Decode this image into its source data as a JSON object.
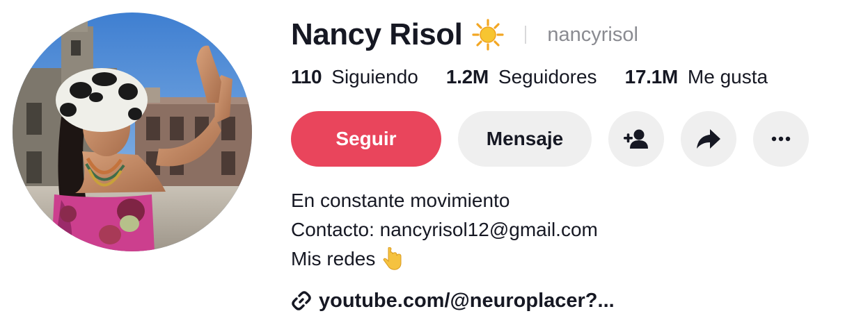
{
  "profile": {
    "display_name": "Nancy Risol",
    "name_emoji": "sun-emoji",
    "username": "nancyrisol"
  },
  "stats": [
    {
      "value": "110",
      "label": "Siguiendo"
    },
    {
      "value": "1.2M",
      "label": "Seguidores"
    },
    {
      "value": "17.1M",
      "label": "Me gusta"
    }
  ],
  "actions": {
    "follow_label": "Seguir",
    "message_label": "Mensaje",
    "add_friend_icon": "add-user-icon",
    "share_icon": "share-arrow-icon",
    "more_icon": "more-dots-icon"
  },
  "bio": {
    "line1": "En constante movimiento",
    "line2": "Contacto: nancyrisol12@gmail.com",
    "line3": "Mis redes",
    "line3_emoji": "pointing-down-emoji"
  },
  "link": {
    "icon": "link-icon",
    "text": "youtube.com/@neuroplacer?..."
  },
  "colors": {
    "follow_button": "#e9455c",
    "secondary_button": "#efefef",
    "text_primary": "#161823",
    "text_secondary": "#8a8b91"
  }
}
